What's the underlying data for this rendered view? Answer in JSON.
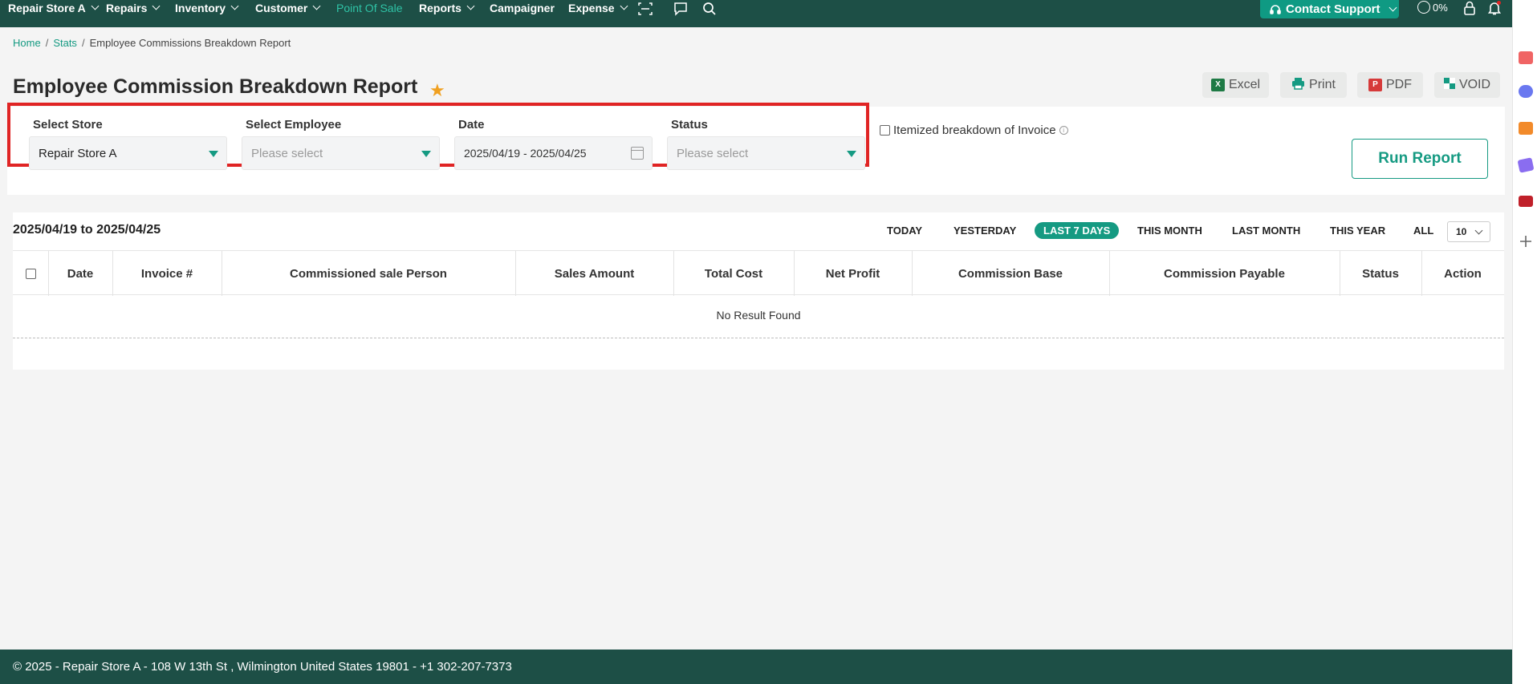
{
  "nav": {
    "store": "Repair Store A",
    "items": [
      {
        "label": "Repairs"
      },
      {
        "label": "Inventory"
      },
      {
        "label": "Customer"
      },
      {
        "label": "Point Of Sale"
      },
      {
        "label": "Reports"
      },
      {
        "label": "Campaigner"
      },
      {
        "label": "Expense"
      }
    ],
    "contact_support": "Contact Support",
    "progress": "0%"
  },
  "breadcrumb": {
    "home": "Home",
    "stats": "Stats",
    "current": "Employee Commissions Breakdown Report"
  },
  "page_title": "Employee Commission Breakdown Report",
  "toolbar": {
    "excel": "Excel",
    "print": "Print",
    "pdf": "PDF",
    "void": "VOID"
  },
  "filters": {
    "store_label": "Select Store",
    "store_value": "Repair Store A",
    "employee_label": "Select Employee",
    "employee_placeholder": "Please select",
    "date_label": "Date",
    "date_value": "2025/04/19 - 2025/04/25",
    "status_label": "Status",
    "status_placeholder": "Please select",
    "itemized_label": "Itemized breakdown of Invoice",
    "run_report": "Run Report"
  },
  "results": {
    "range": "2025/04/19 to 2025/04/25",
    "periods": [
      "TODAY",
      "YESTERDAY",
      "LAST 7 DAYS",
      "THIS MONTH",
      "LAST MONTH",
      "THIS YEAR",
      "ALL"
    ],
    "active_period": "LAST 7 DAYS",
    "page_size": "10",
    "columns": [
      "Date",
      "Invoice #",
      "Commissioned sale Person",
      "Sales Amount",
      "Total Cost",
      "Net Profit",
      "Commission Base",
      "Commission Payable",
      "Status",
      "Action"
    ],
    "empty_message": "No Result Found"
  },
  "footer": "© 2025 - Repair Store A - 108 W 13th St , Wilmington United States 19801 - +1 302-207-7373",
  "colors": {
    "nav_bg": "#1d4f46",
    "accent": "#159a82",
    "highlight_border": "#e02424"
  }
}
